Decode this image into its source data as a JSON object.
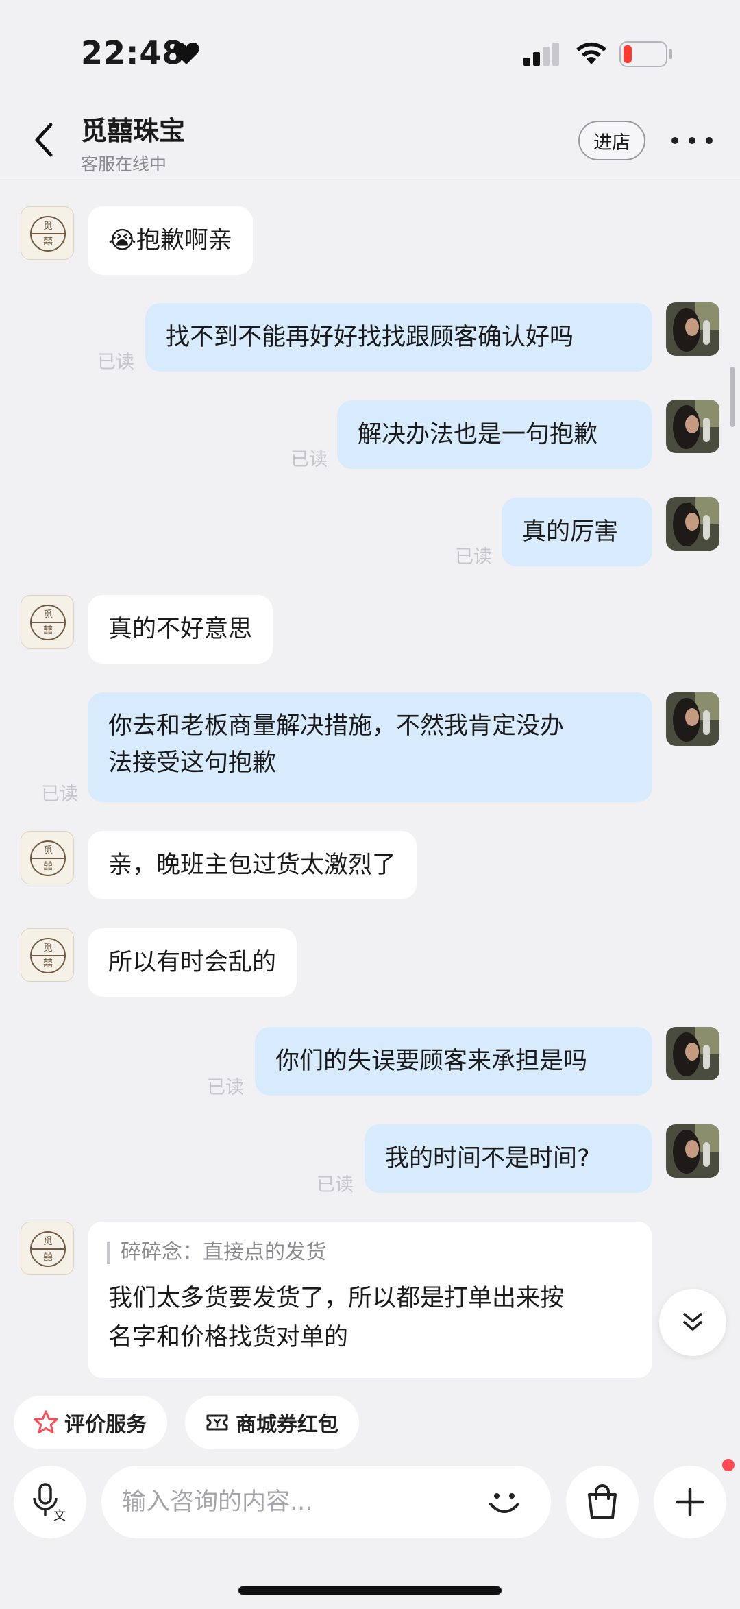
{
  "status_bar": {
    "time": "22:48"
  },
  "header": {
    "shop_name": "觅囍珠宝",
    "status": "客服在线中",
    "enter_shop_label": "进店"
  },
  "shop_avatar_text": "觅囍",
  "read_label": "已读",
  "messages": [
    {
      "side": "left",
      "text": "😭抱歉啊亲"
    },
    {
      "side": "right",
      "text": "找不到不能再好好找找跟顾客确认好吗",
      "status": "已读"
    },
    {
      "side": "right",
      "text": "解决办法也是一句抱歉",
      "status": "已读"
    },
    {
      "side": "right",
      "text": "真的厉害",
      "status": "已读"
    },
    {
      "side": "left",
      "text": "真的不好意思"
    },
    {
      "side": "right",
      "text_line1": "你去和老板商量解决措施，不然我肯定没办",
      "text_line2": "法接受这句抱歉",
      "status": "已读"
    },
    {
      "side": "left",
      "text": "亲，晚班主包过货太激烈了"
    },
    {
      "side": "left",
      "text": "所以有时会乱的"
    },
    {
      "side": "right",
      "text": "你们的失误要顾客来承担是吗",
      "status": "已读"
    },
    {
      "side": "right",
      "text": "我的时间不是时间?",
      "status": "已读"
    },
    {
      "side": "left",
      "quote": "碎碎念：直接点的发货",
      "text_line1": "我们太多货要发货了，所以都是打单出来按",
      "text_line2": "名字和价格找货对单的"
    }
  ],
  "quick_actions": [
    {
      "label": "评价服务",
      "icon": "star-icon"
    },
    {
      "label": "商城券红包",
      "icon": "coupon-icon"
    }
  ],
  "input": {
    "placeholder": "输入咨询的内容...",
    "value": ""
  },
  "colors": {
    "bubble_right": "#d7ebfd",
    "bubble_left": "#ffffff",
    "background": "#f1f1f3",
    "accent": "#ff4a55"
  }
}
